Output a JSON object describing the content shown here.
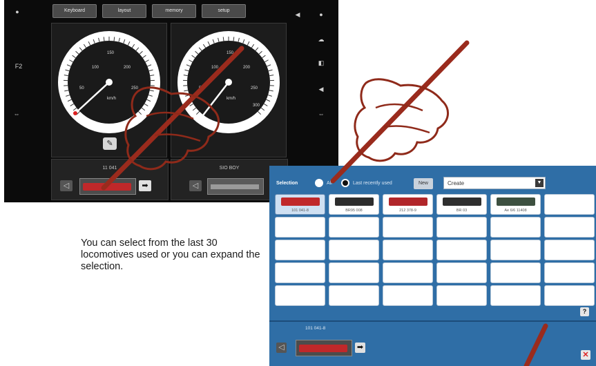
{
  "panel": {
    "tabs": [
      "Keyboard",
      "layout",
      "memory",
      "setup"
    ],
    "left_side_labels": [
      "F2"
    ],
    "gauges": [
      {
        "speed_unit": "km/h",
        "ticks": [
          "50",
          "100",
          "150",
          "200",
          "250"
        ],
        "needle_value": 50
      },
      {
        "speed_unit": "km/h",
        "ticks": [
          "50",
          "100",
          "150",
          "200",
          "250",
          "300"
        ],
        "needle_value": 60
      }
    ],
    "locos": [
      {
        "name": "11 041"
      },
      {
        "name": "SIO BOY"
      }
    ]
  },
  "caption": "You can select from the last 30 locomotives used or you can expand the selection.",
  "selection": {
    "label": "Selection",
    "radio_all": "All",
    "radio_recent": "Last recently used",
    "new_button": "New",
    "dropdown_value": "Create",
    "locomotives": [
      {
        "name": "101 041-8",
        "color": "#c0282a",
        "selected": true
      },
      {
        "name": "BR95 008",
        "color": "#2d2d2d",
        "selected": false
      },
      {
        "name": "212 378-9",
        "color": "#b1262a",
        "selected": false
      },
      {
        "name": "BR 03",
        "color": "#2f2f2f",
        "selected": false
      },
      {
        "name": "Ae 6/6 11408",
        "color": "#3d5040",
        "selected": false
      }
    ],
    "help_button": "?",
    "current_loco": "101 041-8",
    "close_button": "✕"
  },
  "colors": {
    "hand_outline": "#8f2a1a",
    "pen": "#9a2b1d",
    "window_blue": "#2f6ea6",
    "panel_dark": "#0b0b0b"
  }
}
